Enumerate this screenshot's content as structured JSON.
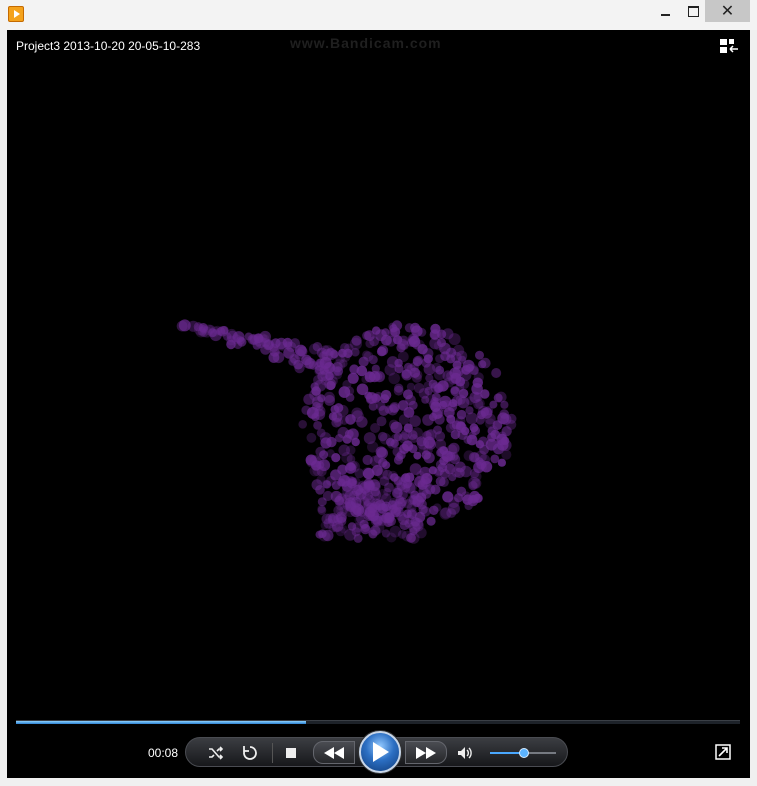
{
  "window": {
    "close_label": "✕"
  },
  "player": {
    "title": "Project3 2013-10-20 20-05-10-283",
    "watermark": "www.Bandicam.com",
    "progress": 0.4,
    "volume": 0.5
  },
  "controls": {
    "time": "00:08"
  },
  "colors": {
    "accent": "#2a7fd0",
    "particle": "#6b2a91",
    "background": "#000000"
  }
}
